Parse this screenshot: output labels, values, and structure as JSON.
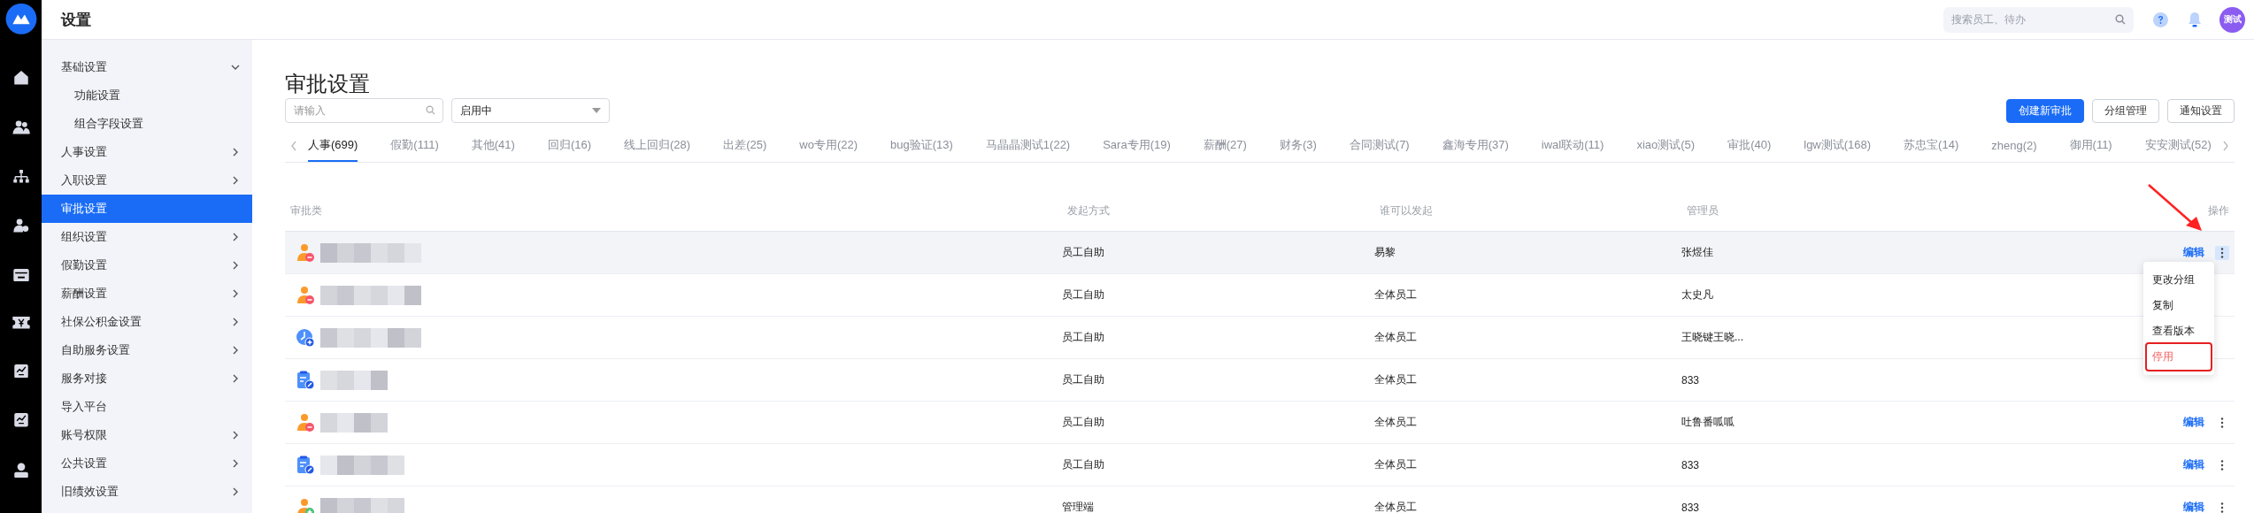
{
  "header": {
    "title": "设置",
    "search_placeholder": "搜索员工、待办",
    "avatar": "测试"
  },
  "rail": [
    {
      "kind": "home"
    },
    {
      "kind": "people"
    },
    {
      "kind": "org"
    },
    {
      "kind": "person-add"
    },
    {
      "kind": "calendar"
    },
    {
      "kind": "money"
    },
    {
      "kind": "chart"
    },
    {
      "kind": "chart"
    },
    {
      "kind": "person"
    }
  ],
  "sidebar": {
    "items": [
      {
        "label": "基础设置",
        "kind": "group",
        "expanded": true,
        "selected": false,
        "children": [
          {
            "label": "功能设置",
            "selected": false
          },
          {
            "label": "组合字段设置",
            "selected": false
          }
        ]
      },
      {
        "label": "人事设置",
        "kind": "group",
        "expanded": false,
        "selected": false
      },
      {
        "label": "入职设置",
        "kind": "group",
        "expanded": false,
        "selected": false
      },
      {
        "label": "审批设置",
        "kind": "link",
        "selected": true
      },
      {
        "label": "组织设置",
        "kind": "group",
        "expanded": false,
        "selected": false
      },
      {
        "label": "假勤设置",
        "kind": "group",
        "expanded": false,
        "selected": false
      },
      {
        "label": "薪酬设置",
        "kind": "group",
        "expanded": false,
        "selected": false
      },
      {
        "label": "社保公积金设置",
        "kind": "group",
        "expanded": false,
        "selected": false
      },
      {
        "label": "自助服务设置",
        "kind": "group",
        "expanded": false,
        "selected": false
      },
      {
        "label": "服务对接",
        "kind": "group",
        "expanded": false,
        "selected": false
      },
      {
        "label": "导入平台",
        "kind": "link",
        "selected": false
      },
      {
        "label": "账号权限",
        "kind": "group",
        "expanded": false,
        "selected": false
      },
      {
        "label": "公共设置",
        "kind": "group",
        "expanded": false,
        "selected": false
      },
      {
        "label": "旧绩效设置",
        "kind": "group",
        "expanded": false,
        "selected": false
      }
    ]
  },
  "page": {
    "title": "审批设置",
    "search_placeholder": "请输入",
    "status_filter": "启用中",
    "buttons": [
      {
        "label": "创建新审批",
        "kind": "primary"
      },
      {
        "label": "分组管理",
        "kind": "default"
      },
      {
        "label": "通知设置",
        "kind": "default"
      }
    ]
  },
  "tabs": [
    {
      "label": "人事(699)",
      "selected": true
    },
    {
      "label": "假勤(111)",
      "selected": false
    },
    {
      "label": "其他(41)",
      "selected": false
    },
    {
      "label": "回归(16)",
      "selected": false
    },
    {
      "label": "线上回归(28)",
      "selected": false
    },
    {
      "label": "出差(25)",
      "selected": false
    },
    {
      "label": "wo专用(22)",
      "selected": false
    },
    {
      "label": "bug验证(13)",
      "selected": false
    },
    {
      "label": "马晶晶测试1(22)",
      "selected": false
    },
    {
      "label": "Sara专用(19)",
      "selected": false
    },
    {
      "label": "薪酬(27)",
      "selected": false
    },
    {
      "label": "财务(3)",
      "selected": false
    },
    {
      "label": "合同测试(7)",
      "selected": false
    },
    {
      "label": "鑫海专用(37)",
      "selected": false
    },
    {
      "label": "iwal联动(11)",
      "selected": false
    },
    {
      "label": "xiao测试(5)",
      "selected": false
    },
    {
      "label": "审批(40)",
      "selected": false
    },
    {
      "label": "lgw测试(168)",
      "selected": false
    },
    {
      "label": "苏忠宝(14)",
      "selected": false
    },
    {
      "label": "zheng(2)",
      "selected": false
    },
    {
      "label": "御用(11)",
      "selected": false
    },
    {
      "label": "安安测试(52)",
      "selected": false
    }
  ],
  "table": {
    "columns": [
      "审批类",
      "发起方式",
      "谁可以发起",
      "管理员",
      "操作"
    ],
    "rows": [
      {
        "kind": "person-minus",
        "method": "员工自助",
        "initiator": "易黎",
        "admin": "张煜佳",
        "hovered": true,
        "edit": "编辑",
        "more_open": true
      },
      {
        "kind": "person-minus",
        "method": "员工自助",
        "initiator": "全体员工",
        "admin": "太史凡",
        "hovered": false
      },
      {
        "kind": "clock-plus",
        "method": "员工自助",
        "initiator": "全体员工",
        "admin": "王晓键王晓...",
        "hovered": false
      },
      {
        "kind": "clipboard-edit",
        "method": "员工自助",
        "initiator": "全体员工",
        "admin": "833",
        "hovered": false
      },
      {
        "kind": "person-minus",
        "method": "员工自助",
        "initiator": "全体员工",
        "admin": "吐鲁番呱呱",
        "hovered": false,
        "edit": "编辑",
        "more_open": false
      },
      {
        "kind": "clipboard-edit",
        "method": "员工自助",
        "initiator": "全体员工",
        "admin": "833",
        "hovered": false,
        "edit": "编辑",
        "more_open": false
      },
      {
        "kind": "person-plus",
        "method": "管理端",
        "initiator": "全体员工",
        "admin": "833",
        "hovered": false,
        "edit": "编辑",
        "more_open": false
      }
    ]
  },
  "row_menu": {
    "items": [
      {
        "label": "更改分组",
        "kind": "normal",
        "boxed": false
      },
      {
        "label": "复制",
        "kind": "normal",
        "boxed": false
      },
      {
        "label": "查看版本",
        "kind": "normal",
        "boxed": false
      },
      {
        "label": "停用",
        "kind": "danger",
        "boxed": true
      }
    ]
  }
}
